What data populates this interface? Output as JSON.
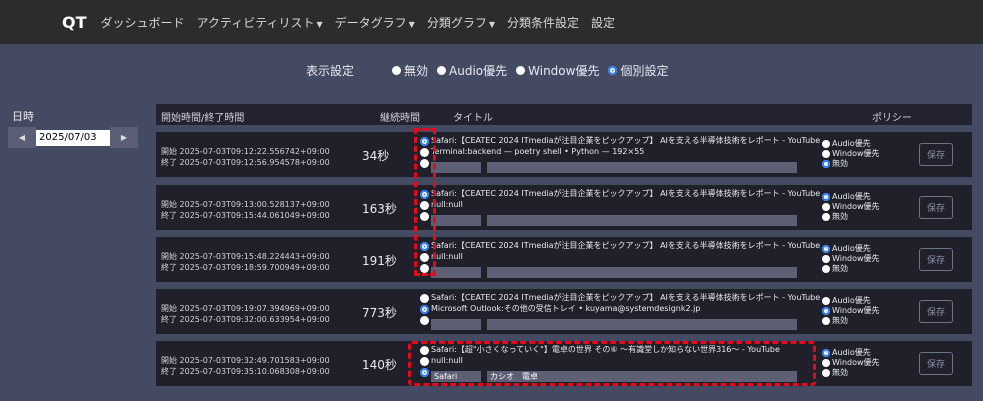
{
  "nav": {
    "brand": "QT",
    "items": [
      {
        "label": "ダッシュボード",
        "caret": false
      },
      {
        "label": "アクティビティリスト",
        "caret": true
      },
      {
        "label": "データグラフ",
        "caret": true
      },
      {
        "label": "分類グラフ",
        "caret": true
      },
      {
        "label": "分類条件設定",
        "caret": false
      },
      {
        "label": "設定",
        "caret": false
      }
    ]
  },
  "display": {
    "label": "表示設定",
    "options": [
      "無効",
      "Audio優先",
      "Window優先",
      "個別設定"
    ],
    "selected": 3
  },
  "date": {
    "label": "日時",
    "value": "2025/07/03"
  },
  "table": {
    "headers": {
      "time": "開始時間/終了時間",
      "duration": "継続時間",
      "title": "タイトル",
      "policy": "ポリシー"
    }
  },
  "policy_options": [
    "Audio優先",
    "Window優先",
    "無効"
  ],
  "save_label": "保存",
  "rows": [
    {
      "start": "開始 2025-07-03T09:12:22.556742+09:00",
      "end": "終了 2025-07-03T09:12:56.954578+09:00",
      "duration": "34秒",
      "selected_title": 0,
      "titles": [
        "Safari:【CEATEC 2024 ITmediaが注目企業をピックアップ】 AIを支える半導体技術をレポート - YouTube",
        "Terminal:backend — poetry shell • Python — 192×55"
      ],
      "custom_app": "",
      "custom_title": "",
      "policy": 2
    },
    {
      "start": "開始 2025-07-03T09:13:00.528137+09:00",
      "end": "終了 2025-07-03T09:15:44.061049+09:00",
      "duration": "163秒",
      "selected_title": 0,
      "titles": [
        "Safari:【CEATEC 2024 ITmediaが注目企業をピックアップ】 AIを支える半導体技術をレポート - YouTube",
        "null:null"
      ],
      "custom_app": "",
      "custom_title": "",
      "policy": 0
    },
    {
      "start": "開始 2025-07-03T09:15:48.224443+09:00",
      "end": "終了 2025-07-03T09:18:59.700949+09:00",
      "duration": "191秒",
      "selected_title": 0,
      "titles": [
        "Safari:【CEATEC 2024 ITmediaが注目企業をピックアップ】 AIを支える半導体技術をレポート - YouTube",
        "null:null"
      ],
      "custom_app": "",
      "custom_title": "",
      "policy": 0
    },
    {
      "start": "開始 2025-07-03T09:19:07.394969+09:00",
      "end": "終了 2025-07-03T09:32:00.633954+09:00",
      "duration": "773秒",
      "selected_title": 1,
      "titles": [
        "Safari:【CEATEC 2024 ITmediaが注目企業をピックアップ】 AIを支える半導体技術をレポート - YouTube",
        "Microsoft Outlook:その他の受信トレイ • kuyama@systemdesignk2.jp"
      ],
      "custom_app": "",
      "custom_title": "",
      "policy": 1
    },
    {
      "start": "開始 2025-07-03T09:32:49.701583+09:00",
      "end": "終了 2025-07-03T09:35:10.068308+09:00",
      "duration": "140秒",
      "selected_title": 2,
      "titles": [
        "Safari:【超\"小さくなっていく\"】電卓の世界 その⑥ ～有識堂しか知らない世界316～ - YouTube",
        "null:null"
      ],
      "custom_app": "Safari",
      "custom_title": "カシオ　電卓",
      "policy": 0
    }
  ]
}
